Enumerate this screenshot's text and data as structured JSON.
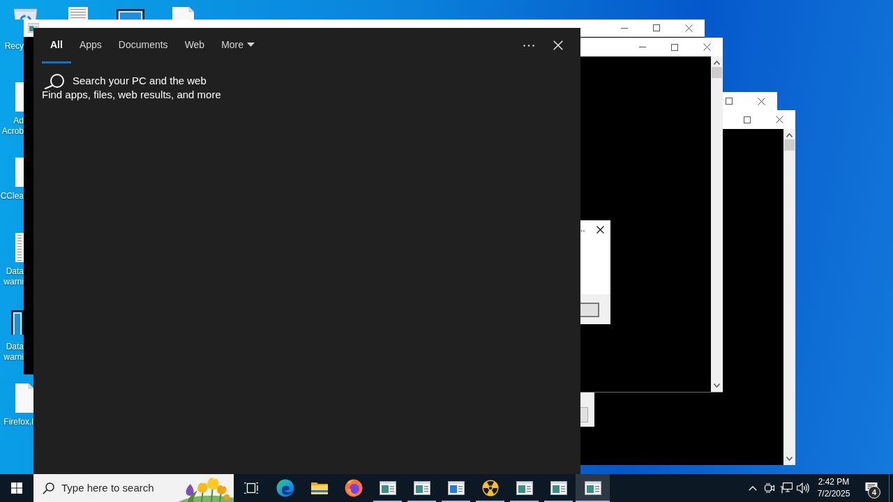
{
  "desktop": {
    "top_icons": [
      {
        "kind": "text-file"
      },
      {
        "kind": "app"
      },
      {
        "kind": "blank-file"
      }
    ],
    "icons": [
      {
        "kind": "recycle-bin",
        "label": "Recy"
      },
      {
        "kind": "blank-file",
        "label": "Ad Acrob"
      },
      {
        "kind": "blank-file",
        "label": "CClea"
      },
      {
        "kind": "text-file",
        "label": "Data warni"
      },
      {
        "kind": "app",
        "label": "Data warni"
      },
      {
        "kind": "blank-file",
        "label": "Firefox.l"
      }
    ]
  },
  "dialog": {
    "title": ".."
  },
  "search_panel": {
    "tabs": [
      {
        "label": "All",
        "selected": true
      },
      {
        "label": "Apps",
        "selected": false
      },
      {
        "label": "Documents",
        "selected": false
      },
      {
        "label": "Web",
        "selected": false
      },
      {
        "label": "More",
        "selected": false,
        "kind": "dropdown"
      }
    ],
    "heading": "Search your PC and the web",
    "subheading": "Find apps, files, web results, and more"
  },
  "taskbar": {
    "search": {
      "placeholder": "Type here to search"
    },
    "apps": [
      {
        "kind": "task-view",
        "running": false,
        "active": false
      },
      {
        "kind": "swirl-browser",
        "running": false,
        "active": false
      },
      {
        "kind": "folder",
        "running": false,
        "active": false
      },
      {
        "kind": "fox-browser",
        "running": false,
        "active": false
      },
      {
        "kind": "window-app",
        "running": true,
        "active": false
      },
      {
        "kind": "window-app",
        "running": true,
        "active": false
      },
      {
        "kind": "blue-window-app",
        "running": true,
        "active": false
      },
      {
        "kind": "hazard-app",
        "running": true,
        "active": false
      },
      {
        "kind": "window-app",
        "running": true,
        "active": false
      },
      {
        "kind": "window-app",
        "running": true,
        "active": false
      },
      {
        "kind": "window-app",
        "running": true,
        "active": true
      }
    ],
    "clock": {
      "time": "2:42 PM",
      "date": "7/2/2025"
    },
    "notifications": {
      "count": "4"
    }
  }
}
